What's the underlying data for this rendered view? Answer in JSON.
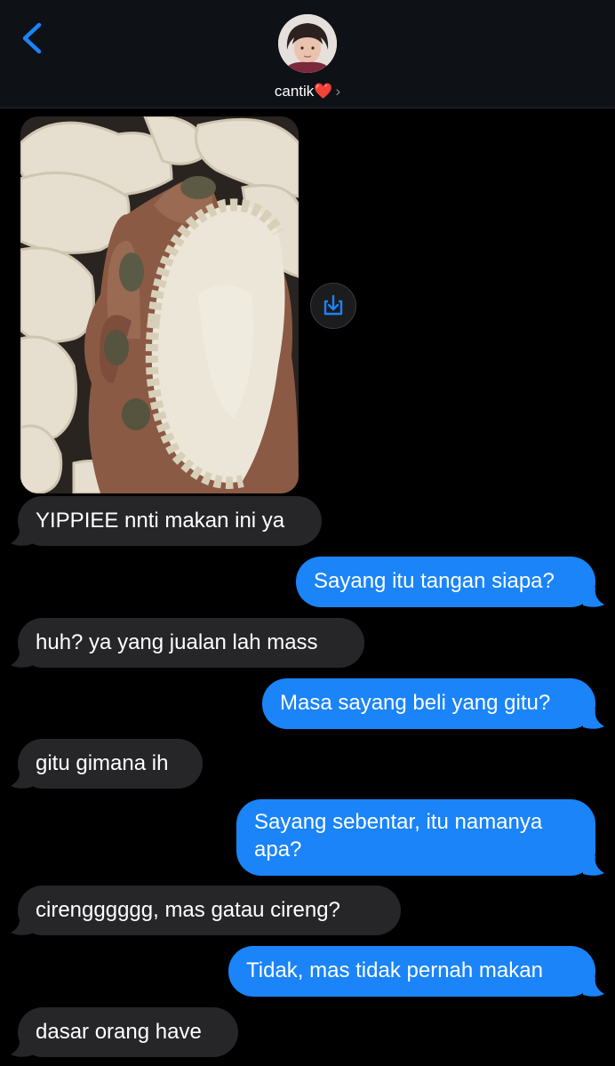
{
  "header": {
    "contact_name": "cantik",
    "contact_emoji": "❤️",
    "chevron": "›",
    "back_icon": "chevron-left-icon",
    "accent": "#1a84f8"
  },
  "thread": {
    "image_description_hidden": null,
    "messages": [
      {
        "from": "them",
        "text": "YIPPIEE nnti makan ini ya"
      },
      {
        "from": "me",
        "text": "Sayang itu tangan siapa?"
      },
      {
        "from": "them",
        "text": "huh? ya yang jualan lah mass"
      },
      {
        "from": "me",
        "text": "Masa sayang beli yang gitu?"
      },
      {
        "from": "them",
        "text": "gitu gimana ih"
      },
      {
        "from": "me",
        "line1": "Sayang sebentar, itu namanya",
        "line2": "apa?"
      },
      {
        "from": "them",
        "text": "cirengggggg, mas gatau cireng?"
      },
      {
        "from": "me",
        "text": "Tidak, mas tidak pernah makan"
      },
      {
        "from": "them",
        "text": "dasar orang have"
      }
    ]
  },
  "colors": {
    "sent_bubble": "#1a84f8",
    "received_bubble": "#262628",
    "background": "#000000"
  }
}
